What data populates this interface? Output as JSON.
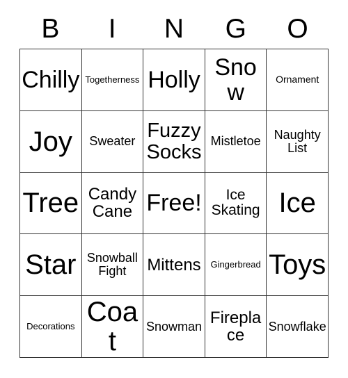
{
  "card": {
    "title_letters": [
      "B",
      "I",
      "N",
      "G",
      "O"
    ],
    "colors": {
      "background": "#ffffff",
      "cell_background": "#ffffff",
      "border": "#333333",
      "text": "#000000"
    },
    "rows": [
      [
        {
          "label": "Chilly",
          "size": "fs-xl"
        },
        {
          "label": "Togetherness",
          "size": "fs-min"
        },
        {
          "label": "Holly",
          "size": "fs-xl"
        },
        {
          "label": "Snow",
          "size": "fs-xl"
        },
        {
          "label": "Ornament",
          "size": "fs-xxs"
        }
      ],
      [
        {
          "label": "Joy",
          "size": "fs-xxl"
        },
        {
          "label": "Sweater",
          "size": "fs-xs"
        },
        {
          "label": "Fuzzy Socks",
          "size": "fs-lg"
        },
        {
          "label": "Mistletoe",
          "size": "fs-xs"
        },
        {
          "label": "Naughty List",
          "size": "fs-xs"
        }
      ],
      [
        {
          "label": "Tree",
          "size": "fs-xxl"
        },
        {
          "label": "Candy Cane",
          "size": "fs-md"
        },
        {
          "label": "Free!",
          "size": "fs-xl"
        },
        {
          "label": "Ice Skating",
          "size": "fs-sm"
        },
        {
          "label": "Ice",
          "size": "fs-xxl"
        }
      ],
      [
        {
          "label": "Star",
          "size": "fs-xxl"
        },
        {
          "label": "Snowball Fight",
          "size": "fs-xs"
        },
        {
          "label": "Mittens",
          "size": "fs-md"
        },
        {
          "label": "Gingerbread",
          "size": "fs-min"
        },
        {
          "label": "Toys",
          "size": "fs-xxl"
        }
      ],
      [
        {
          "label": "Decorations",
          "size": "fs-min"
        },
        {
          "label": "Coat",
          "size": "fs-xxl"
        },
        {
          "label": "Snowman",
          "size": "fs-xs"
        },
        {
          "label": "Fireplace",
          "size": "fs-md"
        },
        {
          "label": "Snowflake",
          "size": "fs-xs"
        }
      ]
    ]
  }
}
